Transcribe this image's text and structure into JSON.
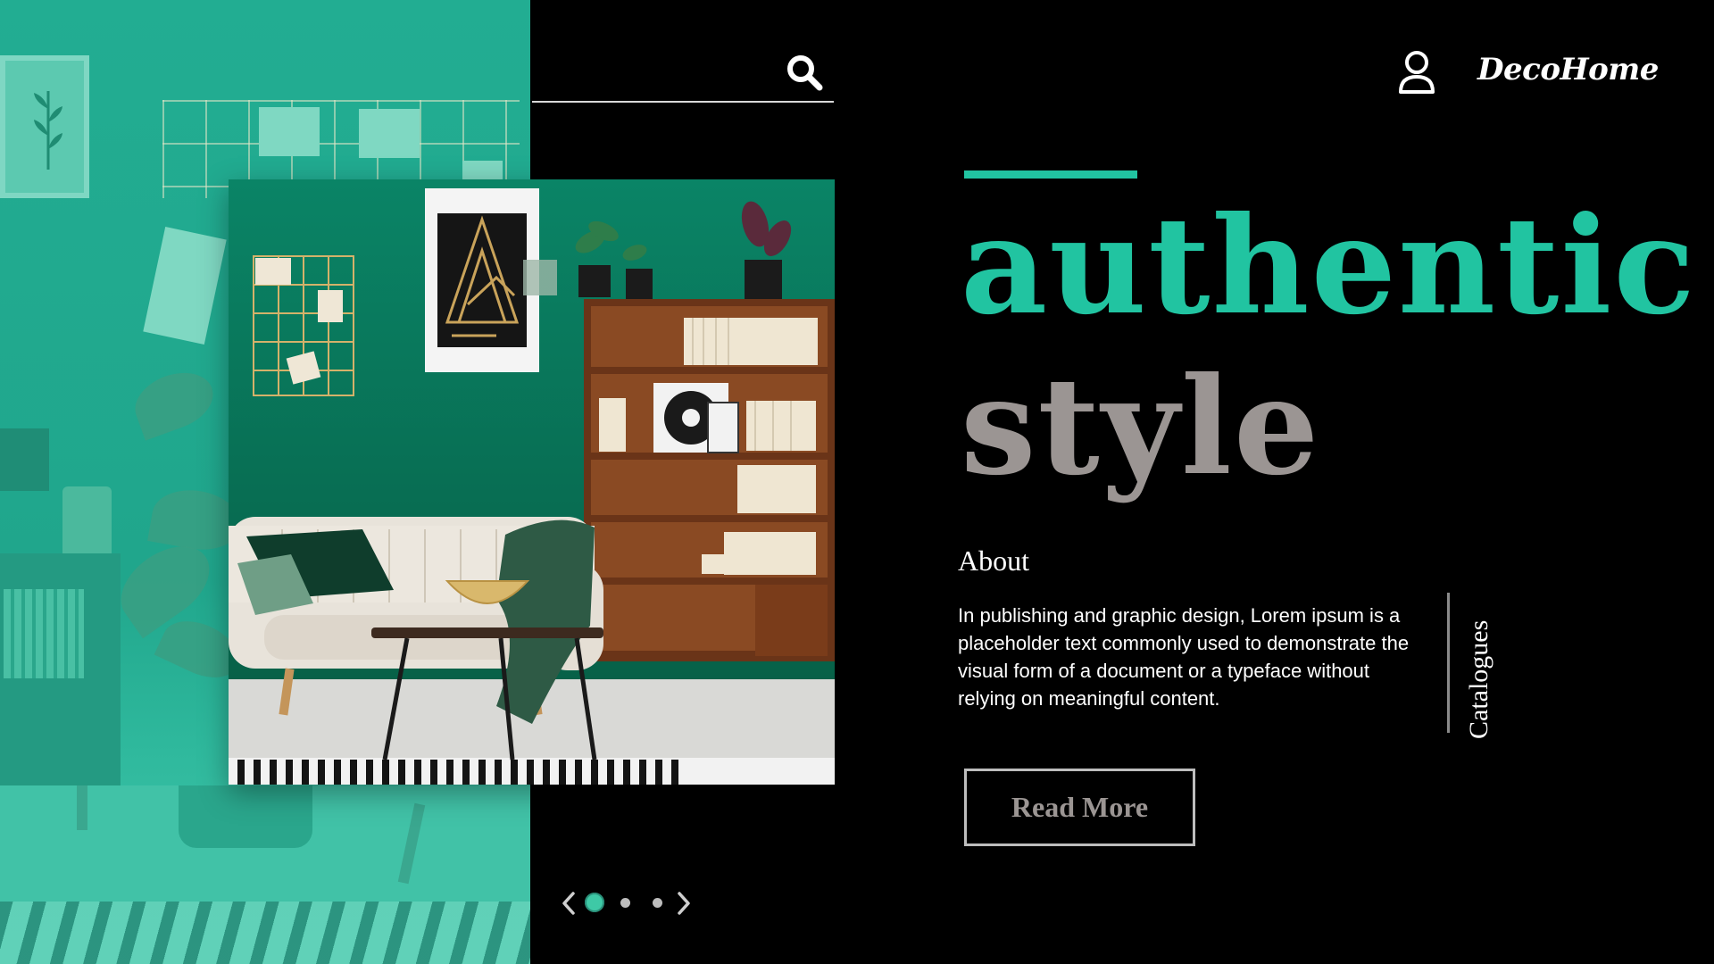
{
  "brand": {
    "name": "DecoHome"
  },
  "header": {
    "search_icon": "search-icon",
    "user_icon": "user-icon"
  },
  "hero": {
    "headline_primary": "authentic",
    "headline_secondary": "style",
    "image_icon": "living-room-photo"
  },
  "about": {
    "title": "About",
    "body": "In publishing and graphic design, Lorem ipsum is a placeholder text commonly used to demonstrate the visual form of a document or a typeface without relying on meaningful content."
  },
  "sidebar": {
    "catalogues_label": "Catalogues"
  },
  "cta": {
    "read_more_label": "Read More"
  },
  "carousel": {
    "total_slides": 3,
    "active_slide": 1,
    "prev_icon": "chevron-left-icon",
    "next_icon": "chevron-right-icon"
  },
  "colors": {
    "accent": "#21c4a1",
    "secondary_text": "#9b9593",
    "background": "#000000",
    "left_panel": "#22ad92"
  }
}
